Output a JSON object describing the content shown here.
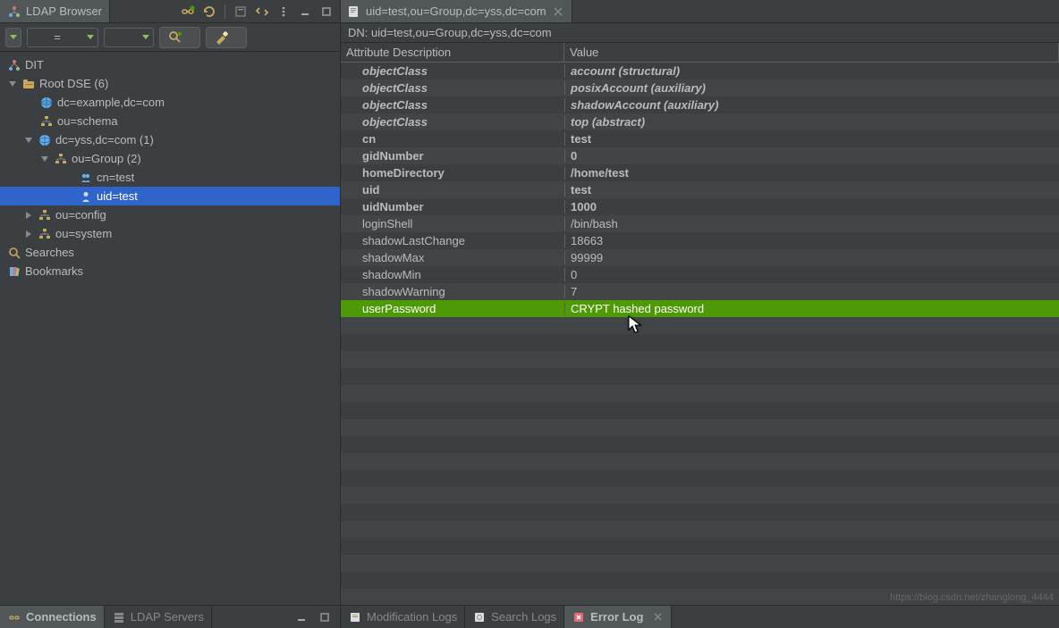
{
  "browser_tab": {
    "title": "LDAP Browser"
  },
  "editor_tab": {
    "title": "uid=test,ou=Group,dc=yss,dc=com"
  },
  "dn_bar": {
    "label": "DN: uid=test,ou=Group,dc=yss,dc=com"
  },
  "left_toolbar": {
    "eq": "="
  },
  "tree": {
    "dit": "DIT",
    "root_dse": "Root DSE (6)",
    "dc_example": "dc=example,dc=com",
    "ou_schema": "ou=schema",
    "dc_yss": "dc=yss,dc=com (1)",
    "ou_group": "ou=Group (2)",
    "cn_test": "cn=test",
    "uid_test": "uid=test",
    "ou_config": "ou=config",
    "ou_system": "ou=system",
    "searches": "Searches",
    "bookmarks": "Bookmarks"
  },
  "table": {
    "header_attr": "Attribute Description",
    "header_val": "Value",
    "rows": [
      {
        "attr": "objectClass",
        "val": "account (structural)",
        "ib": true
      },
      {
        "attr": "objectClass",
        "val": "posixAccount (auxiliary)",
        "ib": true
      },
      {
        "attr": "objectClass",
        "val": "shadowAccount (auxiliary)",
        "ib": true
      },
      {
        "attr": "objectClass",
        "val": "top (abstract)",
        "ib": true
      },
      {
        "attr": "cn",
        "val": "test",
        "bold": true
      },
      {
        "attr": "gidNumber",
        "val": "0",
        "bold": true
      },
      {
        "attr": "homeDirectory",
        "val": "/home/test",
        "bold": true
      },
      {
        "attr": "uid",
        "val": "test",
        "bold": true
      },
      {
        "attr": "uidNumber",
        "val": "1000",
        "bold": true
      },
      {
        "attr": "loginShell",
        "val": "/bin/bash"
      },
      {
        "attr": "shadowLastChange",
        "val": "18663"
      },
      {
        "attr": "shadowMax",
        "val": "99999"
      },
      {
        "attr": "shadowMin",
        "val": "0"
      },
      {
        "attr": "shadowWarning",
        "val": "7"
      },
      {
        "attr": "userPassword",
        "val": "CRYPT hashed password",
        "highlight": true
      }
    ],
    "empty_rows": 17
  },
  "bottom": {
    "connections": "Connections",
    "ldap_servers": "LDAP Servers",
    "mod_logs": "Modification Logs",
    "search_logs": "Search Logs",
    "error_log": "Error Log"
  },
  "watermark": "https://blog.csdn.net/zhanglong_4444"
}
